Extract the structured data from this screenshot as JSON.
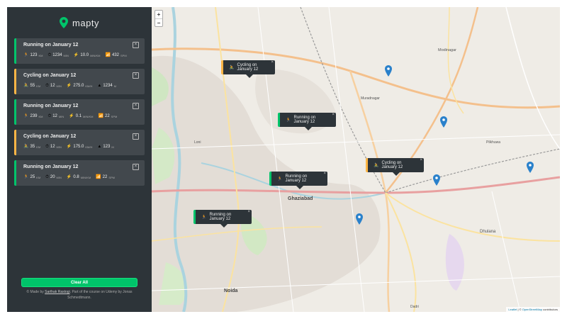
{
  "app": {
    "name": "mapty"
  },
  "workouts": [
    {
      "type": "running",
      "title": "Running on January 12",
      "icon1": "🏃",
      "v1": "123",
      "u1": "KM",
      "v2": "1234",
      "u2": "MIN",
      "icon3": "⚡",
      "v3": "10.0",
      "u3": "MIN/KM",
      "icon4": "📶",
      "v4": "432",
      "u4": "SPM"
    },
    {
      "type": "cycling",
      "title": "Cycling on January 12",
      "icon1": "🚴",
      "v1": "55",
      "u1": "KM",
      "v2": "12",
      "u2": "MIN",
      "icon3": "⚡",
      "v3": "275.0",
      "u3": "KM/H",
      "icon4": "▲",
      "v4": "1234",
      "u4": "M"
    },
    {
      "type": "running",
      "title": "Running on January 12",
      "icon1": "🏃",
      "v1": "239",
      "u1": "KM",
      "v2": "12",
      "u2": "MIN",
      "icon3": "⚡",
      "v3": "0.1",
      "u3": "MIN/KM",
      "icon4": "📶",
      "v4": "22",
      "u4": "SPM"
    },
    {
      "type": "cycling",
      "title": "Cycling on January 12",
      "icon1": "🚴",
      "v1": "35",
      "u1": "KM",
      "v2": "12",
      "u2": "MIN",
      "icon3": "⚡",
      "v3": "175.0",
      "u3": "KM/H",
      "icon4": "▲",
      "v4": "123",
      "u4": "M"
    },
    {
      "type": "running",
      "title": "Running on January 12",
      "icon1": "🏃",
      "v1": "25",
      "u1": "KM",
      "v2": "20",
      "u2": "MIN",
      "icon3": "⚡",
      "v3": "0.8",
      "u3": "MIN/KM",
      "icon4": "📶",
      "v4": "22",
      "u4": "SPM"
    }
  ],
  "clear_label": "Clear All",
  "copyright": {
    "prefix": "© Made by ",
    "author": "Sarthak Rastogi",
    "suffix": ". Part of the course on Udemy by Jonas Schmedtmann."
  },
  "map": {
    "zoom_in": "+",
    "zoom_out": "−",
    "attribution_leaflet": "Leaflet",
    "attribution_sep": " | © ",
    "attribution_osm": "OpenStreetMap",
    "attribution_tail": " contributors",
    "labels": {
      "ghaziabad": "Ghaziabad",
      "noida": "Noida",
      "loni": "Loni",
      "dhulana": "Dhulana",
      "pilkhuwa": "Pilkhuwa",
      "modinagar": "Modinagar",
      "muradnagar": "Muradnagar",
      "dadri": "Dadri"
    },
    "popups": [
      {
        "type": "cycling",
        "icon": "🚴",
        "text": "Cycling on January 12"
      },
      {
        "type": "running",
        "icon": "🏃",
        "text": "Running on January 12"
      },
      {
        "type": "running",
        "icon": "🏃",
        "text": "Running on January 12"
      },
      {
        "type": "cycling",
        "icon": "🚴",
        "text": "Cycling on January 12"
      },
      {
        "type": "running",
        "icon": "🏃",
        "text": "Running on January 12"
      }
    ]
  },
  "colors": {
    "running": "#00c46a",
    "cycling": "#ffb545",
    "sidebar": "#2d3439",
    "card": "#42484d",
    "marker": "#2a81cb"
  }
}
